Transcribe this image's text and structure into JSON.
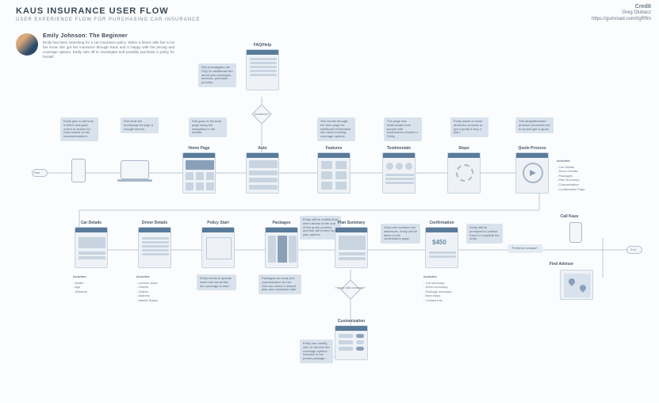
{
  "header": {
    "title": "KAUS INSURANCE USER FLOW",
    "subtitle": "USER EXPERIENCE FLOW FOR PURCHASING CAR INSURANCE"
  },
  "credit": {
    "label": "Credit",
    "name": "Greg Dlubacz",
    "url": "https://gumroad.com/l/gRflm"
  },
  "persona": {
    "name": "Emily Johnson: The Beginner",
    "desc": "Emily has been searching for a car insurance policy. When a friend calls her to let her know she got her insurance through Kaus and is happy with the pricing and coverage options, Emily sets off to investigate and possibly purchase a policy for herself."
  },
  "pills": {
    "start": "Start",
    "end": "End"
  },
  "row1": {
    "faq": "FAQ/Help",
    "faq_note": "She investigates the FAQ for additional info about plan packages, services, purchase process.",
    "diamond": "Questions?"
  },
  "notes_r2": {
    "n1": "Emily gets a call from a friend and goes online to search for Kaus based on her recommendation.",
    "n2": "She finds the homepage through a Google search.",
    "n3": "She goes to the Auto page using the navigation in the header.",
    "n4": "She scrolls through the Auto page for additional information info about exciting coverage options.",
    "n5": "The page has testimonials from people with experiences similar to Emily.",
    "n6": "Emily wants to know about the process to get a quote & buy a plan.",
    "n7": "The straightforward process convinces her to try and get a quote."
  },
  "row2": {
    "home": "Home Page",
    "auto": "Auto",
    "features": "Features",
    "testimonials": "Testimonials",
    "steps": "Steps",
    "quote": "Quote Process"
  },
  "quote_includes": {
    "head": "Includes:",
    "items": "- Car Details\n- Driver Details\n- Packages\n- Plan Summary\n- Customization\n- Confirmation Page"
  },
  "row3": {
    "car": "Car Details",
    "driver": "Driver Details",
    "policy": "Policy Start",
    "packages": "Packages",
    "plan": "Plan Summary",
    "confirm": "Confirmation",
    "call": "Call Kaus",
    "find": "Find Advisor",
    "custom": "Customization"
  },
  "notes_r3": {
    "plan_top": "Emily will be notified that she's almost at the end of the quote process and she will review her plan options.",
    "plan_right": "Once she confirms her selections, Emily will be taken to the confirmation page.",
    "confirm_right": "Emily will be prompted to contact Kaus to complete her order.",
    "pref": "Preferred contact?",
    "diamond2": "Happy with coverage?",
    "custom_note": "Emily can modify, add, or remove her coverage options included in her preset package."
  },
  "includes": {
    "car": {
      "head": "Includes:",
      "body": "- Model\n- Age\n- Distance"
    },
    "driver": {
      "head": "Includes:",
      "body": "- Licence class\n- Tickets\n- Claims\n- Address\n- Marital Status"
    },
    "policy": "Emily needs to specify when she would like her coverage to start.",
    "packages": "Packages do some pre-customization for her. She can select a default plan and customize later.",
    "confirm": {
      "head": "Includes:",
      "body": "- Car summary\n- Driver summary\n- Package summary\n- Next steps\n- Contact info"
    }
  }
}
